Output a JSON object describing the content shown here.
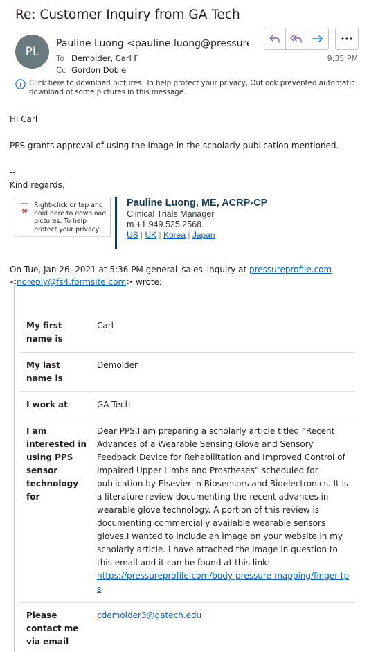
{
  "email": {
    "subject": "Re: Customer Inquiry from GA Tech",
    "avatar_initials": "PL",
    "avatar_color": "#69797e",
    "sender": "Pauline Luong <pauline.luong@pressurepr",
    "to_label": "To",
    "to": "Demolder, Carl F",
    "cc_label": "Cc",
    "cc": "Gordon Dobie",
    "time": "9:35 PM",
    "actions": {
      "reply_icon": "reply-icon",
      "reply_all_icon": "reply-all-icon",
      "forward_icon": "forward-icon",
      "more_icon": "more-icon",
      "accent": "#8764b8",
      "forward_color": "#0078d4"
    },
    "info_line1": "Click here to download pictures. To help protect your privacy, Outlook prevented automatic",
    "info_line2": "download of some pictures in this message."
  },
  "body": {
    "greeting": "Hi Carl",
    "message": "PPS grants approval of using the image in the scholarly publication mentioned.",
    "dashes": "--",
    "closing": "Kind regards,"
  },
  "signature": {
    "image_placeholder_line1": "Right-click or tap and",
    "image_placeholder_line2": "hold here to download",
    "image_placeholder_line3": "pictures. To help",
    "image_placeholder_line4": "protect your privacy,",
    "name": "Pauline Luong, ME, ACRP-CP",
    "title": "Clinical Trials Manager",
    "phone": "m +1.949.525.2568",
    "links": [
      "US",
      "UK",
      "Korea",
      "Japan"
    ],
    "separator": "|",
    "bar_color": "#0f3b4f",
    "name_color": "#173c59"
  },
  "quote": {
    "header_prefix": "On Tue, Jan 26, 2021 at 5:36 PM general_sales_inquiry at ",
    "header_link": "pressureprofile.com",
    "header_lt": "<",
    "header_email": "noreply@fs4.formsite.com",
    "header_suffix": "> wrote:"
  },
  "form": {
    "rows": [
      {
        "key": "My first name is",
        "value": "Carl"
      },
      {
        "key": "My last name is",
        "value": "Demolder"
      },
      {
        "key": "I work at",
        "value": "GA Tech"
      },
      {
        "key": "I am interested in using PPS sensor technology for",
        "value": "Dear PPS,I am preparing a scholarly article titled “Recent Advances of a Wearable Sensing Glove and Sensory Feedback Device for Rehabilitation and Improved Control of Impaired Upper Limbs and Prostheses” scheduled for publication by Elsevier in Biosensors and Bioelectronics. It is a literature review documenting the recent advances in wearable glove technology. A portion of this review is documenting commercially available wearable sensors gloves.I wanted to include an image on your website in my scholarly article. I have attached the image in question to this email and it can be found at this link:",
        "link": "https://pressureprofile.com/body-pressure-mapping/finger-tps"
      },
      {
        "key": "Please contact me via email",
        "link": "cdemolder3@gatech.edu"
      }
    ]
  }
}
